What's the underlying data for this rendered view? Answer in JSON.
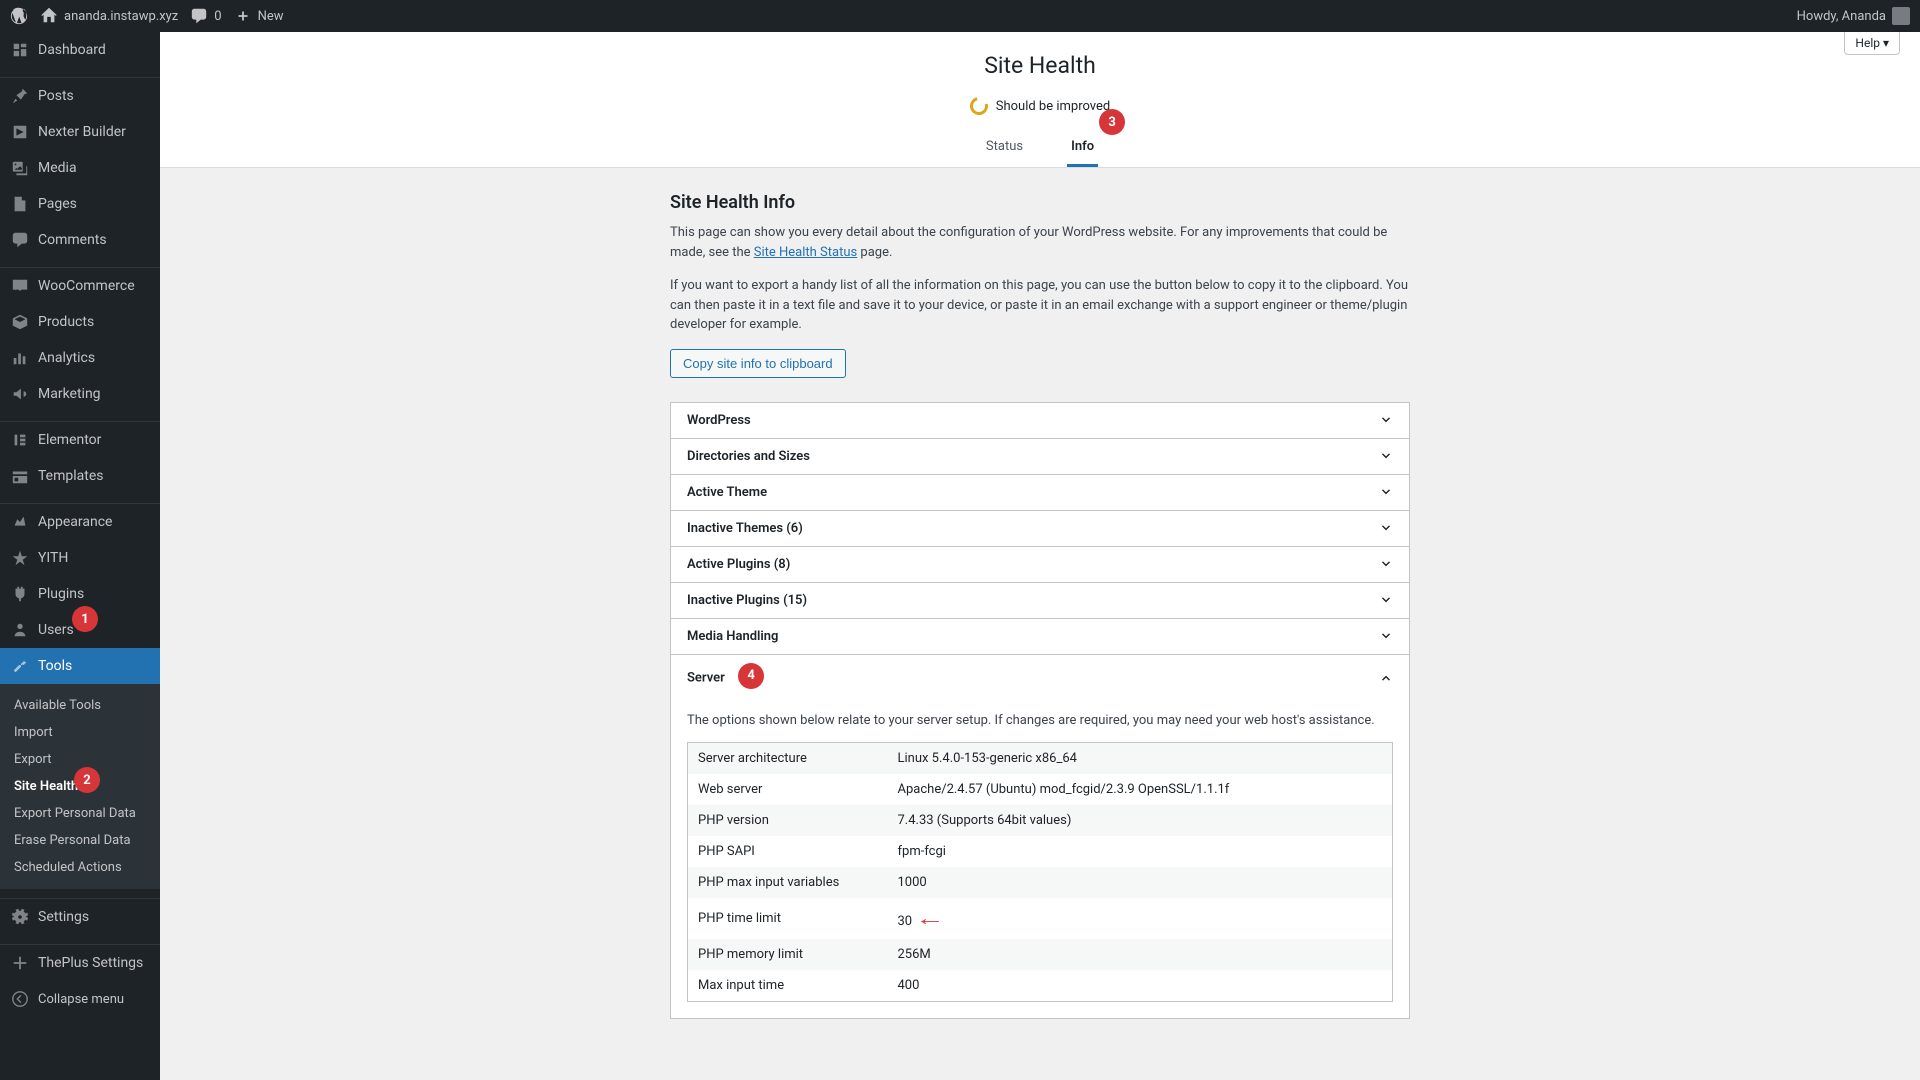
{
  "toolbar": {
    "site": "ananda.instawp.xyz",
    "comments_count": "0",
    "new_label": "New",
    "howdy": "Howdy, Ananda"
  },
  "sidebar": {
    "items": [
      {
        "label": "Dashboard",
        "icon": "dashboard"
      },
      {
        "label": "Posts",
        "icon": "pin"
      },
      {
        "label": "Nexter Builder",
        "icon": "nexter"
      },
      {
        "label": "Media",
        "icon": "media"
      },
      {
        "label": "Pages",
        "icon": "page"
      },
      {
        "label": "Comments",
        "icon": "comment"
      },
      {
        "label": "WooCommerce",
        "icon": "woo"
      },
      {
        "label": "Products",
        "icon": "product"
      },
      {
        "label": "Analytics",
        "icon": "analytics"
      },
      {
        "label": "Marketing",
        "icon": "marketing"
      },
      {
        "label": "Elementor",
        "icon": "elementor"
      },
      {
        "label": "Templates",
        "icon": "templates"
      },
      {
        "label": "Appearance",
        "icon": "appearance"
      },
      {
        "label": "YITH",
        "icon": "yith"
      },
      {
        "label": "Plugins",
        "icon": "plugins"
      },
      {
        "label": "Users",
        "icon": "users"
      },
      {
        "label": "Tools",
        "icon": "tools",
        "active": true
      },
      {
        "label": "Settings",
        "icon": "settings"
      },
      {
        "label": "ThePlus Settings",
        "icon": "theplus"
      },
      {
        "label": "Collapse menu",
        "icon": "collapse"
      }
    ],
    "sub": [
      {
        "label": "Available Tools"
      },
      {
        "label": "Import"
      },
      {
        "label": "Export"
      },
      {
        "label": "Site Health",
        "current": true
      },
      {
        "label": "Export Personal Data"
      },
      {
        "label": "Erase Personal Data"
      },
      {
        "label": "Scheduled Actions"
      }
    ]
  },
  "page": {
    "help_label": "Help ▾",
    "title": "Site Health",
    "status_text": "Should be improved",
    "tab_status": "Status",
    "tab_info": "Info",
    "section_title": "Site Health Info",
    "desc1_a": "This page can show you every detail about the configuration of your WordPress website. For any improvements that could be made, see the ",
    "desc1_link": "Site Health Status",
    "desc1_b": " page.",
    "desc2": "If you want to export a handy list of all the information on this page, you can use the button below to copy it to the clipboard. You can then paste it in a text file and save it to your device, or paste it in an email exchange with a support engineer or theme/plugin developer for example.",
    "copy_btn": "Copy site info to clipboard",
    "accordion": [
      "WordPress",
      "Directories and Sizes",
      "Active Theme",
      "Inactive Themes (6)",
      "Active Plugins (8)",
      "Inactive Plugins (15)",
      "Media Handling",
      "Server"
    ],
    "server_desc": "The options shown below relate to your server setup. If changes are required, you may need your web host's assistance.",
    "server_rows": [
      {
        "k": "Server architecture",
        "v": "Linux 5.4.0-153-generic x86_64"
      },
      {
        "k": "Web server",
        "v": "Apache/2.4.57 (Ubuntu) mod_fcgid/2.3.9 OpenSSL/1.1.1f"
      },
      {
        "k": "PHP version",
        "v": "7.4.33 (Supports 64bit values)"
      },
      {
        "k": "PHP SAPI",
        "v": "fpm-fcgi"
      },
      {
        "k": "PHP max input variables",
        "v": "1000"
      },
      {
        "k": "PHP time limit",
        "v": "30",
        "arrow": true
      },
      {
        "k": "PHP memory limit",
        "v": "256M"
      },
      {
        "k": "Max input time",
        "v": "400"
      }
    ]
  },
  "badges": [
    "1",
    "2",
    "3",
    "4"
  ]
}
